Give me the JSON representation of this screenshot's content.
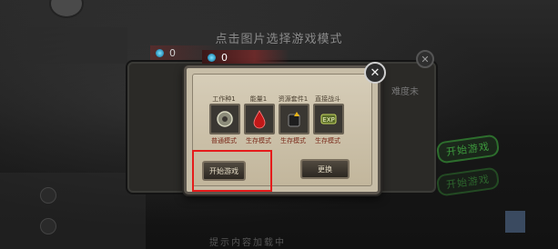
{
  "header": {
    "title": "点击图片选择游戏模式"
  },
  "currency": {
    "back_value": "0",
    "front_value": "0"
  },
  "background": {
    "side_right_top": "难度未",
    "side_button_right": "开始游戏",
    "side_button_right_2": "开始游戏",
    "bottom_hint": "提示内容加载中"
  },
  "dialog": {
    "items": [
      {
        "label": "工作种1",
        "sub": "普通模式",
        "icon": "gear-stamp-icon"
      },
      {
        "label": "能量1",
        "sub": "生存模式",
        "icon": "blood-drop-icon"
      },
      {
        "label": "资源套件1",
        "sub": "生存模式",
        "icon": "backpack-icon"
      },
      {
        "label": "直接战斗",
        "sub": "生存模式",
        "icon": "exp-icon"
      }
    ],
    "start_button": "开始游戏",
    "other_button": "更换"
  },
  "colors": {
    "highlight": "#e51b1b",
    "dialog_bg": "#c7bda7"
  }
}
